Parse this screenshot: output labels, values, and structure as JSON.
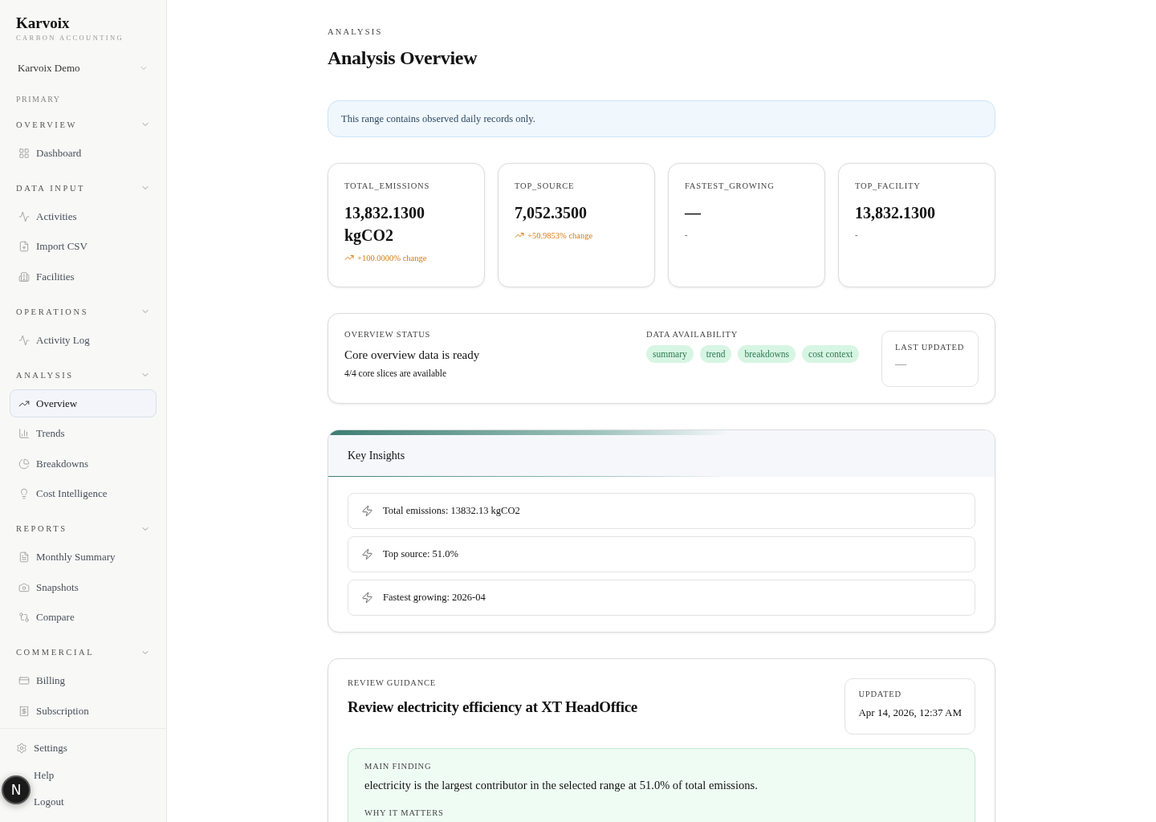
{
  "brand": {
    "name": "Karvoix",
    "tagline": "CARBON ACCOUNTING"
  },
  "workspace": {
    "name": "Karvoix Demo"
  },
  "sidebar": {
    "primary_label": "PRIMARY",
    "groups": [
      {
        "title": "OVERVIEW",
        "expanded": true,
        "items": [
          {
            "label": "Dashboard",
            "selected": false
          }
        ]
      },
      {
        "title": "DATA INPUT",
        "expanded": true,
        "items": [
          {
            "label": "Activities",
            "selected": false
          },
          {
            "label": "Import CSV",
            "selected": false
          },
          {
            "label": "Facilities",
            "selected": false
          }
        ]
      },
      {
        "title": "OPERATIONS",
        "expanded": true,
        "items": [
          {
            "label": "Activity Log",
            "selected": false
          }
        ]
      },
      {
        "title": "ANALYSIS",
        "expanded": true,
        "items": [
          {
            "label": "Overview",
            "selected": true
          },
          {
            "label": "Trends",
            "selected": false
          },
          {
            "label": "Breakdowns",
            "selected": false
          },
          {
            "label": "Cost Intelligence",
            "selected": false
          }
        ]
      },
      {
        "title": "REPORTS",
        "expanded": true,
        "items": [
          {
            "label": "Monthly Summary",
            "selected": false
          },
          {
            "label": "Snapshots",
            "selected": false
          },
          {
            "label": "Compare",
            "selected": false
          }
        ]
      },
      {
        "title": "COMMERCIAL",
        "expanded": true,
        "items": [
          {
            "label": "Billing",
            "selected": false
          },
          {
            "label": "Subscription",
            "selected": false
          }
        ]
      }
    ],
    "footer": [
      "Settings",
      "Help",
      "Logout"
    ]
  },
  "dev_badge": "N",
  "header": {
    "eyebrow": "ANALYSIS",
    "title": "Analysis Overview"
  },
  "notice": "This range contains observed daily records only.",
  "metrics": [
    {
      "kind": "rising",
      "label": "TOTAL_EMISSIONS",
      "value": "13,832.1300 kgCO2",
      "change": "+100.0000% change"
    },
    {
      "kind": "rising",
      "label": "TOP_SOURCE",
      "value": "7,052.3500",
      "change": "+50.9853% change"
    },
    {
      "kind": "plain",
      "label": "FASTEST_GROWING",
      "value": "—",
      "change": "-"
    },
    {
      "kind": "plain",
      "label": "TOP_FACILITY",
      "value": "13,832.1300",
      "change": "-"
    }
  ],
  "status": {
    "label": "OVERVIEW STATUS",
    "title": "Core overview data is ready",
    "detail": "4/4 core slices are available",
    "availability_label": "DATA AVAILABILITY",
    "tags": [
      "summary",
      "trend",
      "breakdowns",
      "cost context"
    ],
    "updated_label": "LAST UPDATED",
    "updated_value": "—"
  },
  "insights": {
    "title": "Key Insights",
    "items": [
      "Total emissions: 13832.13 kgCO2",
      "Top source: 51.0%",
      "Fastest growing: 2026-04"
    ]
  },
  "guidance": {
    "label": "REVIEW GUIDANCE",
    "title": "Review electricity efficiency at XT HeadOffice",
    "updated_label": "UPDATED",
    "updated_value": "Apr 14, 2026, 12:37 AM",
    "finding_label": "MAIN FINDING",
    "finding": "electricity is the largest contributor in the selected range at 51.0% of total emissions.",
    "why_label": "WHY IT MATTERS"
  }
}
